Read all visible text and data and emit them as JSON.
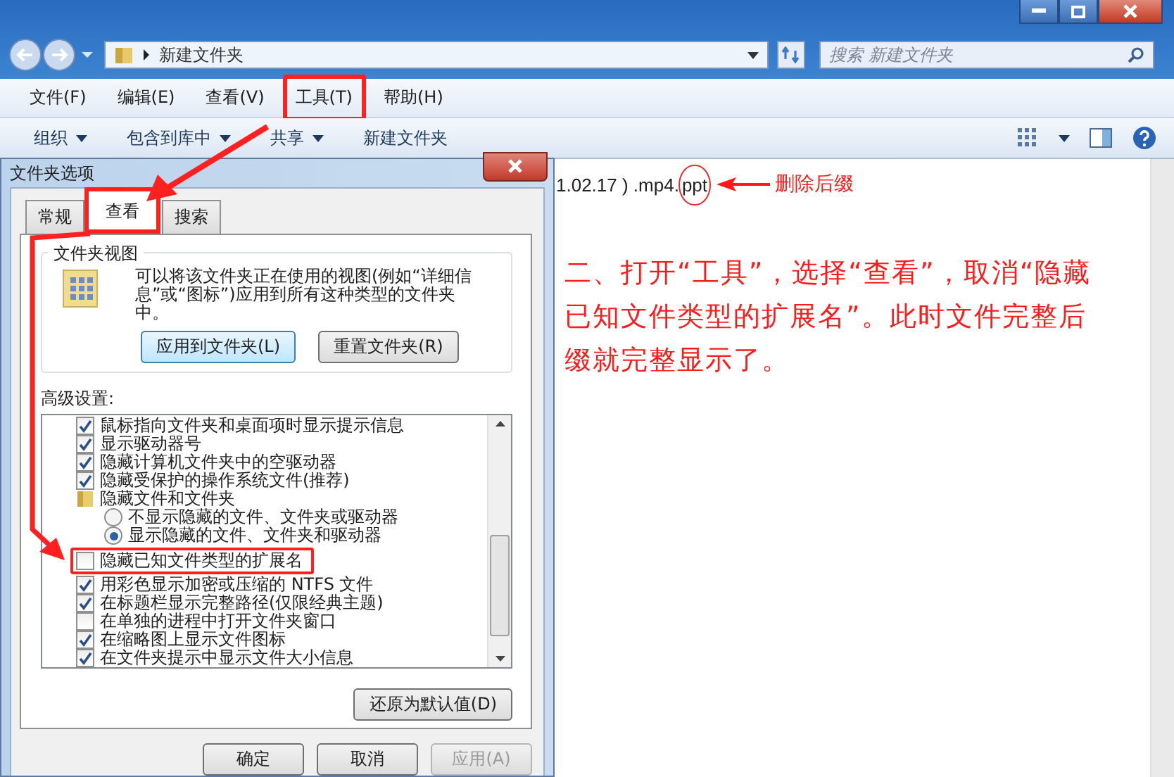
{
  "explorer": {
    "address": "新建文件夹",
    "search": {
      "placeholder": "搜索 新建文件夹"
    },
    "menu": [
      {
        "label": "文件(F)",
        "highlighted": false
      },
      {
        "label": "编辑(E)",
        "highlighted": false
      },
      {
        "label": "查看(V)",
        "highlighted": false
      },
      {
        "label": "工具(T)",
        "highlighted": true
      },
      {
        "label": "帮助(H)",
        "highlighted": false
      }
    ],
    "toolbar": [
      {
        "label": "组织",
        "dropdown": true
      },
      {
        "label": "包含到库中",
        "dropdown": true
      },
      {
        "label": "共享",
        "dropdown": true
      },
      {
        "label": "新建文件夹",
        "dropdown": false
      }
    ],
    "file_name": "1.02.17 ) .mp4.",
    "file_extension": "ppt"
  },
  "annotations": {
    "extension_label": "删除后缀",
    "instruction": "二、打开“工具”，选择“查看”，取消“隐藏已知文件类型的扩展名”。此时文件完整后缀就完整显示了。"
  },
  "dialog": {
    "title": "文件夹选项",
    "tabs": [
      {
        "label": "常规",
        "selected": false,
        "highlighted": false
      },
      {
        "label": "查看",
        "selected": true,
        "highlighted": true
      },
      {
        "label": "搜索",
        "selected": false,
        "highlighted": false
      }
    ],
    "folder_views": {
      "title": "文件夹视图",
      "description": "可以将该文件夹正在使用的视图(例如“详细信息”或“图标”)应用到所有这种类型的文件夹中。",
      "buttons": [
        {
          "label": "应用到文件夹(L)",
          "focused": true
        },
        {
          "label": "重置文件夹(R)",
          "focused": false
        }
      ]
    },
    "advanced_label": "高级设置:",
    "settings": [
      {
        "kind": "checkbox",
        "label": "鼠标指向文件夹和桌面项时显示提示信息",
        "checked": true
      },
      {
        "kind": "checkbox",
        "label": "显示驱动器号",
        "checked": true
      },
      {
        "kind": "checkbox",
        "label": "隐藏计算机文件夹中的空驱动器",
        "checked": true
      },
      {
        "kind": "checkbox",
        "label": "隐藏受保护的操作系统文件(推荐)",
        "checked": true
      },
      {
        "kind": "folder",
        "label": "隐藏文件和文件夹",
        "children": [
          {
            "kind": "radio",
            "label": "不显示隐藏的文件、文件夹或驱动器",
            "selected": false
          },
          {
            "kind": "radio",
            "label": "显示隐藏的文件、文件夹和驱动器",
            "selected": true
          }
        ]
      },
      {
        "kind": "checkbox",
        "label": "隐藏已知文件类型的扩展名",
        "checked": false,
        "highlighted": true
      },
      {
        "kind": "checkbox",
        "label": "用彩色显示加密或压缩的 NTFS 文件",
        "checked": true
      },
      {
        "kind": "checkbox",
        "label": "在标题栏显示完整路径(仅限经典主题)",
        "checked": true
      },
      {
        "kind": "checkbox",
        "label": "在单独的进程中打开文件夹窗口",
        "checked": false
      },
      {
        "kind": "checkbox",
        "label": "在缩略图上显示文件图标",
        "checked": true
      },
      {
        "kind": "checkbox",
        "label": "在文件夹提示中显示文件大小信息",
        "checked": true
      }
    ],
    "restore_button": "还原为默认值(D)",
    "footer_buttons": [
      {
        "label": "确定",
        "disabled": false
      },
      {
        "label": "取消",
        "disabled": false
      },
      {
        "label": "应用(A)",
        "disabled": true
      }
    ]
  }
}
